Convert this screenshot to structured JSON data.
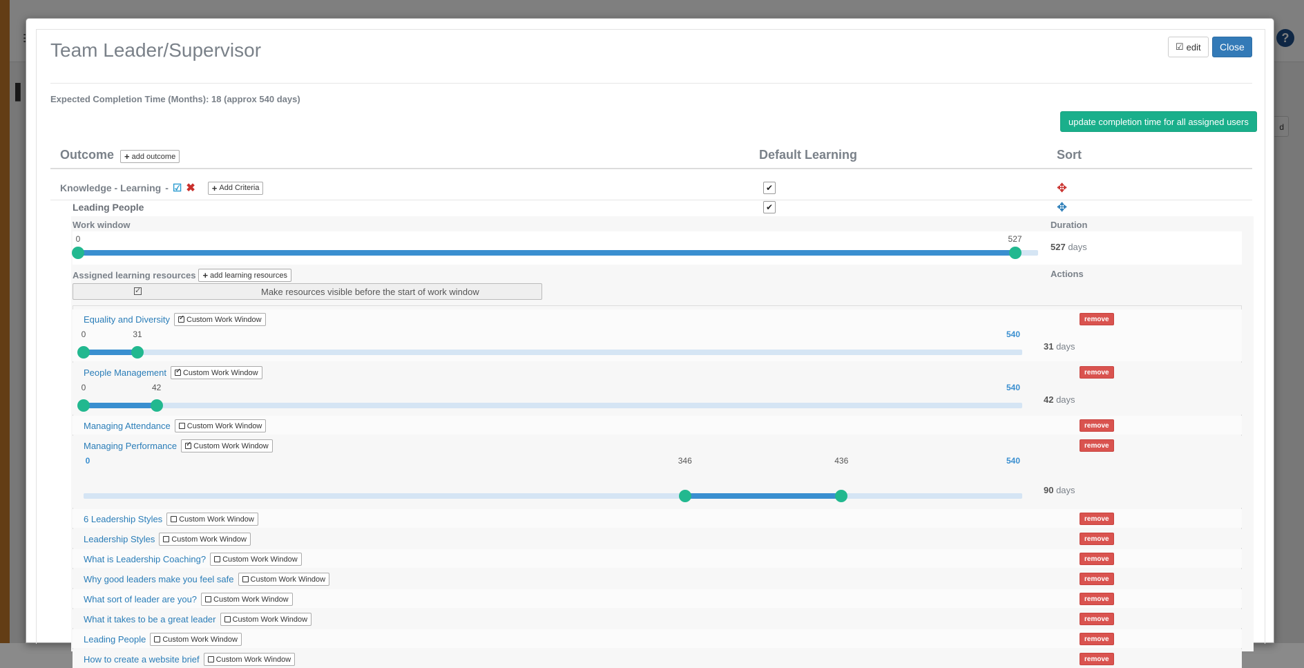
{
  "modal": {
    "title": "Team Leader/Supervisor",
    "edit_label": "edit",
    "close_label": "Close",
    "expected_completion": "Expected Completion Time (Months): 18 (approx 540 days)",
    "update_button": "update completion time for all assigned users"
  },
  "table": {
    "headers": {
      "outcome": "Outcome",
      "add_outcome": "add outcome",
      "default_learning": "Default Learning",
      "sort": "Sort"
    },
    "outcome": {
      "name": "Knowledge - Learning",
      "separator": "-",
      "add_criteria": "Add Criteria",
      "default_learning_checked": true
    },
    "criteria": {
      "name": "Leading People",
      "default_learning_checked": true,
      "work_window_label": "Work window",
      "duration_label": "Duration",
      "work_window": {
        "start": 0,
        "end": 527,
        "max": 540
      },
      "work_window_start_label": "0",
      "work_window_end_label": "527",
      "duration_value": "527",
      "duration_unit": "days",
      "assigned_label": "Assigned learning resources",
      "add_resources": "add learning resources",
      "actions_label": "Actions",
      "visible_before_label": "Make resources visible before the start of work window",
      "visible_before_checked": true
    }
  },
  "resources": {
    "custom_window_label": "Custom Work Window",
    "remove_label": "remove",
    "max_label": "540",
    "days_unit": "days",
    "items": [
      {
        "name": "Equality and Diversity",
        "custom": true,
        "start": 0,
        "end": 31,
        "start_label": "0",
        "end_label": "31",
        "duration": "31"
      },
      {
        "name": "People Management",
        "custom": true,
        "start": 0,
        "end": 42,
        "start_label": "0",
        "end_label": "42",
        "duration": "42"
      },
      {
        "name": "Managing Attendance",
        "custom": false
      },
      {
        "name": "Managing Performance",
        "custom": true,
        "start": 346,
        "end": 436,
        "start_label": "346",
        "end_label": "436",
        "min_label": "0",
        "duration": "90"
      },
      {
        "name": "6 Leadership Styles",
        "custom": false
      },
      {
        "name": "Leadership Styles",
        "custom": false
      },
      {
        "name": "What is Leadership Coaching?",
        "custom": false
      },
      {
        "name": "Why good leaders make you feel safe",
        "custom": false
      },
      {
        "name": "What sort of leader are you?",
        "custom": false
      },
      {
        "name": "What it takes to be a great leader",
        "custom": false
      },
      {
        "name": "Leading People",
        "custom": false
      },
      {
        "name": "How to create a website brief",
        "custom": false
      }
    ]
  },
  "colors": {
    "primary": "#337ab7",
    "success": "#1aaf8b",
    "danger": "#d9534f",
    "slider_fill": "#3a8fd0",
    "slider_handle": "#22b88f",
    "link": "#2a7db8"
  }
}
